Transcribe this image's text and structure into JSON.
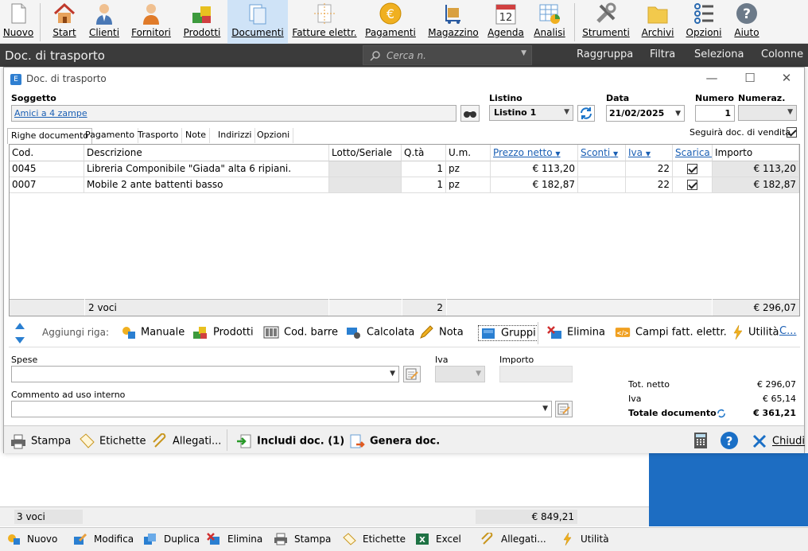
{
  "ribbon": {
    "items": [
      {
        "label": "Nuovo",
        "icon": "new-document-icon"
      },
      {
        "label": "Start",
        "icon": "home-icon"
      },
      {
        "label": "Clienti",
        "icon": "customer-icon"
      },
      {
        "label": "Fornitori",
        "icon": "supplier-icon"
      },
      {
        "label": "Prodotti",
        "icon": "products-icon"
      },
      {
        "label": "Documenti",
        "icon": "documents-icon"
      },
      {
        "label": "Fatture elettr.",
        "icon": "e-invoice-icon"
      },
      {
        "label": "Pagamenti",
        "icon": "euro-coin-icon"
      },
      {
        "label": "Magazzino",
        "icon": "warehouse-icon"
      },
      {
        "label": "Agenda",
        "icon": "calendar-icon",
        "badge": "12"
      },
      {
        "label": "Analisi",
        "icon": "analysis-chart-icon"
      },
      {
        "label": "Strumenti",
        "icon": "tools-icon"
      },
      {
        "label": "Archivi",
        "icon": "folder-icon"
      },
      {
        "label": "Opzioni",
        "icon": "options-icon"
      },
      {
        "label": "Aiuto",
        "icon": "help-icon"
      }
    ]
  },
  "titlebar": {
    "title": "Doc. di trasporto",
    "search_placeholder": "Cerca n.",
    "buttons": [
      "Raggruppa",
      "Filtra",
      "Seleziona",
      "Colonne"
    ]
  },
  "window": {
    "title": "Doc. di trasporto",
    "soggetto_label": "Soggetto",
    "soggetto_value": "Amici a 4 zampe",
    "listino_label": "Listino",
    "listino_value": "Listino 1",
    "data_label": "Data",
    "data_value": "21/02/2025",
    "numero_label": "Numero",
    "numero_value": "1",
    "numeraz_label": "Numeraz.",
    "tabs": [
      "Righe documento",
      "Pagamento",
      "Trasporto",
      "Note",
      "Indirizzi",
      "Opzioni"
    ],
    "seguira_label": "Seguirà doc. di vendita"
  },
  "grid": {
    "headers": [
      "Cod.",
      "Descrizione",
      "Lotto/Seriale",
      "Q.tà",
      "U.m.",
      "Prezzo netto",
      "Sconti",
      "Iva",
      "Scarica m",
      "Importo"
    ],
    "rows": [
      {
        "cod": "0045",
        "desc": "Libreria Componibile \"Giada\" alta 6 ripiani.",
        "qta": "1",
        "um": "pz",
        "prezzo": "€ 113,20",
        "iva": "22",
        "importo": "€ 113,20"
      },
      {
        "cod": "0007",
        "desc": "Mobile 2 ante battenti basso",
        "qta": "1",
        "um": "pz",
        "prezzo": "€ 182,87",
        "iva": "22",
        "importo": "€ 182,87"
      }
    ],
    "footer_count": "2 voci",
    "footer_qta": "2",
    "footer_total": "€ 296,07"
  },
  "rowbar": {
    "label": "Aggiungi riga:",
    "buttons": [
      "Manuale",
      "Prodotti",
      "Cod. barre",
      "Calcolata",
      "Nota",
      "Gruppi",
      "Elimina",
      "Campi fatt. elettr.",
      "Utilità",
      "C..."
    ]
  },
  "form": {
    "spese_label": "Spese",
    "iva_label": "Iva",
    "importo_label": "Importo",
    "commento_label": "Commento ad uso interno"
  },
  "totals": {
    "netto_label": "Tot. netto",
    "netto_value": "€ 296,07",
    "iva_label": "Iva",
    "iva_value": "€ 65,14",
    "totale_label": "Totale documento",
    "totale_value": "€ 361,21"
  },
  "footbar": {
    "stampa": "Stampa",
    "etichette": "Etichette",
    "allegati": "Allegati...",
    "includi": "Includi doc. (1)",
    "genera": "Genera doc.",
    "chiudi": "Chiudi"
  },
  "background_list": {
    "count": "3 voci",
    "total": "€ 849,21"
  },
  "bottombar": [
    "Nuovo",
    "Modifica",
    "Duplica",
    "Elimina",
    "Stampa",
    "Etichette",
    "Excel",
    "Allegati...",
    "Utilità"
  ]
}
